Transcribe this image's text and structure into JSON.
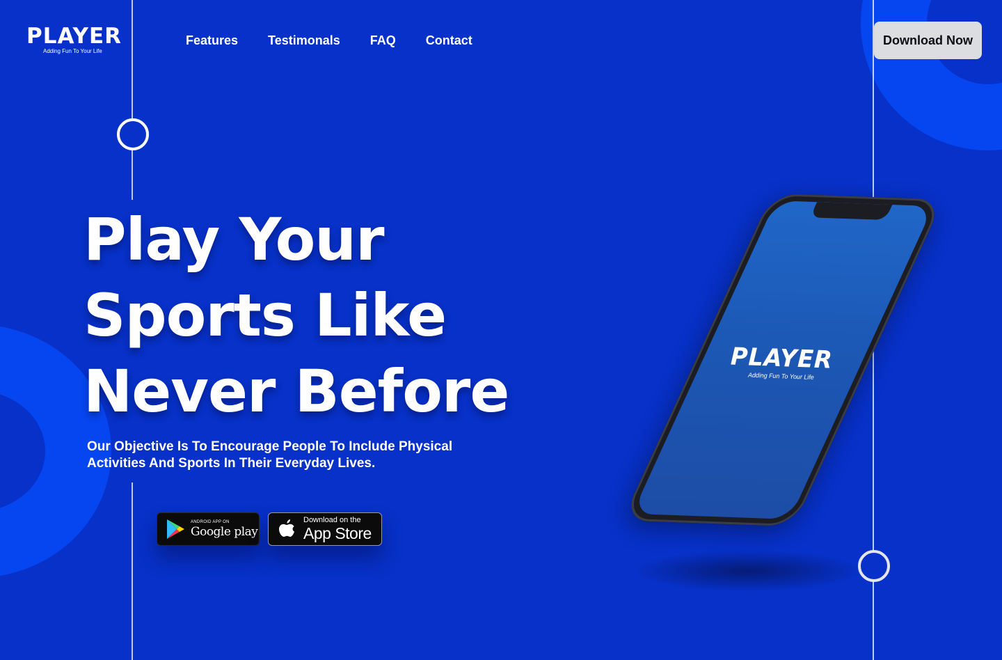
{
  "brand": {
    "name": "PLAYER",
    "tagline": "Adding Fun To Your Life"
  },
  "nav": {
    "links": [
      "Features",
      "Testimonals",
      "FAQ",
      "Contact"
    ],
    "cta_label": "Download Now"
  },
  "hero": {
    "headline_lines": [
      "Play Your",
      "Sports Like",
      "Never Before"
    ],
    "subtext": "Our Objective Is To Encourage People To Include Physical Activities And Sports In Their Everyday Lives."
  },
  "stores": {
    "google": {
      "small": "ANDROID APP ON",
      "big": "Google play"
    },
    "apple": {
      "small": "Download on the",
      "big": "App Store"
    }
  },
  "phone": {
    "logo": "PLAYER",
    "tagline": "Adding Fun To Your Life"
  },
  "colors": {
    "background": "#0731c8",
    "ring": "#0646f0",
    "cta_bg": "#dcdde0",
    "phone_screen": "#1c58b5"
  }
}
